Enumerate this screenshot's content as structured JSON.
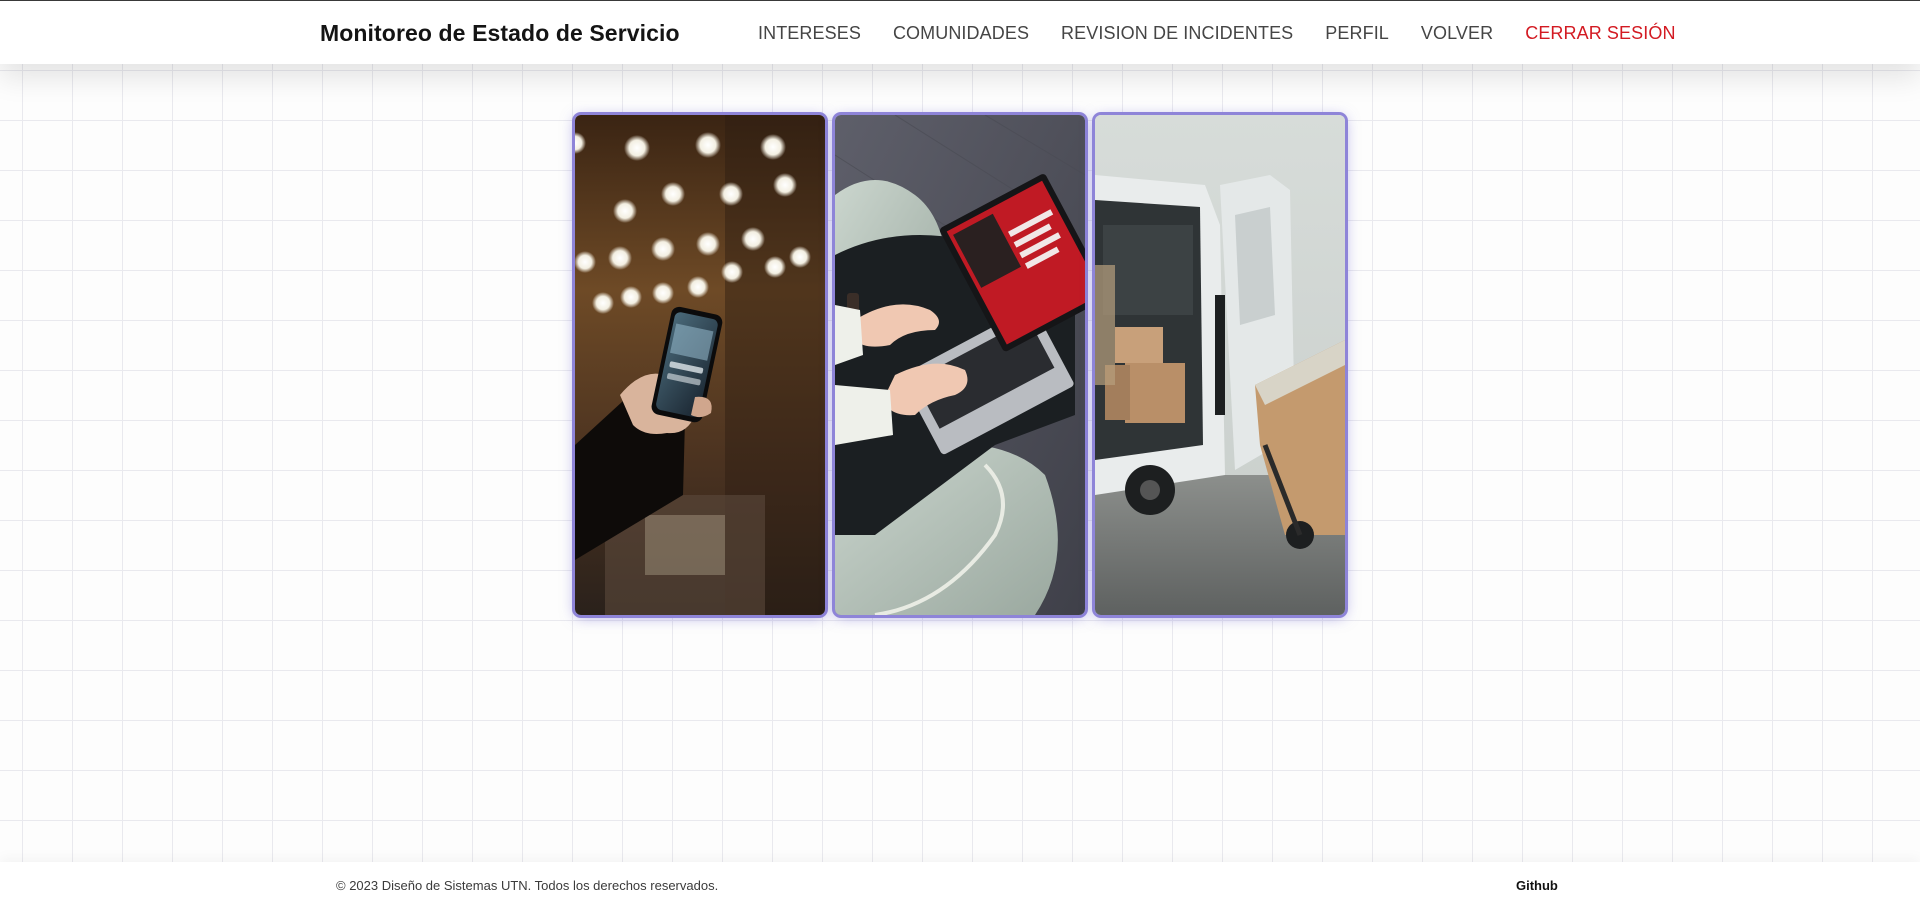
{
  "header": {
    "brand": "Monitoreo de Estado de Servicio",
    "nav": [
      {
        "label": "INTERESES"
      },
      {
        "label": "COMUNIDADES"
      },
      {
        "label": "REVISION DE INCIDENTES"
      },
      {
        "label": "PERFIL"
      },
      {
        "label": "VOLVER"
      },
      {
        "label": "CERRAR SESIÓN"
      }
    ]
  },
  "gallery": {
    "images": [
      {
        "subject": "hand-holding-smartphone-photo"
      },
      {
        "subject": "person-typing-on-laptop-photo"
      },
      {
        "subject": "delivery-van-with-boxes-photo"
      }
    ],
    "frame_color": "#8e84d8"
  },
  "footer": {
    "copyright": "© 2023 Diseño de Sistemas UTN. Todos los derechos reservados.",
    "github_label": "Github"
  },
  "colors": {
    "danger": "#d31a22",
    "nav_text": "#454545",
    "brand_text": "#141414"
  }
}
